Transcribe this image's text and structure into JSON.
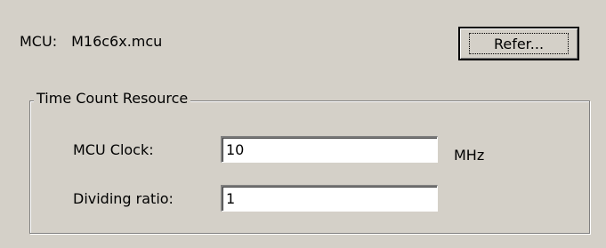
{
  "mcu": {
    "label": "MCU:",
    "value": "M16c6x.mcu",
    "refer_label": "Refer..."
  },
  "time_count_resource": {
    "title": "Time Count Resource",
    "mcu_clock": {
      "label": "MCU Clock:",
      "value": "10",
      "unit": "MHz"
    },
    "dividing_ratio": {
      "label": "Dividing ratio:",
      "value": "1"
    }
  }
}
